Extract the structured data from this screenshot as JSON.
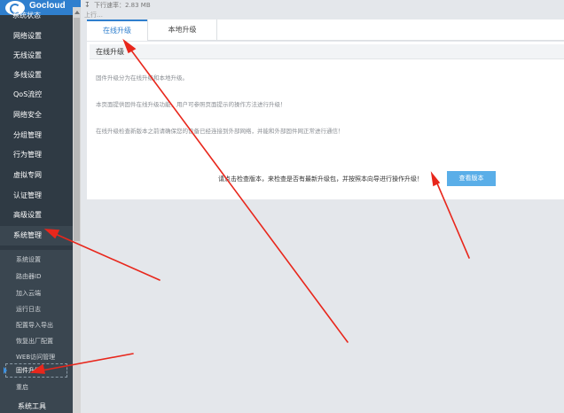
{
  "brand": {
    "logo_text": "Gocloud",
    "clipped_item": "系统状态"
  },
  "status": {
    "download_icon": "download-arrow-icon",
    "download_text": "下行速率：2.83 MB",
    "upload_clipped": "上行…"
  },
  "sidebar": {
    "items": [
      {
        "label": "网络设置"
      },
      {
        "label": "无线设置"
      },
      {
        "label": "多线设置"
      },
      {
        "label": "QoS流控"
      },
      {
        "label": "网络安全"
      },
      {
        "label": "分组管理"
      },
      {
        "label": "行为管理"
      },
      {
        "label": "虚拟专网"
      },
      {
        "label": "认证管理"
      },
      {
        "label": "高级设置"
      },
      {
        "label": "系统管理"
      }
    ],
    "sub_items": [
      {
        "label": "系统设置"
      },
      {
        "label": "路由器ID"
      },
      {
        "label": "加入云端"
      },
      {
        "label": "运行日志"
      },
      {
        "label": "配置导入导出"
      },
      {
        "label": "恢复出厂配置"
      },
      {
        "label": "WEB访问管理"
      },
      {
        "label": "固件升级"
      },
      {
        "label": "重启"
      }
    ],
    "bottom_item": "系统工具"
  },
  "tabs": [
    {
      "label": "在线升级"
    },
    {
      "label": "本地升级"
    }
  ],
  "panel": {
    "title": "在线升级",
    "line1": "固件升级分为在线升级和本地升级。",
    "line2": "本页面提供固件在线升级功能，用户可参照页面提示的操作方法进行升级！",
    "line3": "在线升级检查新版本之前请确保您的设备已经连接到外部网络，并能和外部固件网正常进行通信！",
    "check_text": "请点击检查版本，来检查是否有最新升级包，并按照本向导进行操作升级！",
    "check_button": "查看版本"
  },
  "colors": {
    "accent": "#2f7fce",
    "sidebar": "#2f3a44",
    "button": "#5aaee8",
    "annotation": "#e8271c"
  }
}
